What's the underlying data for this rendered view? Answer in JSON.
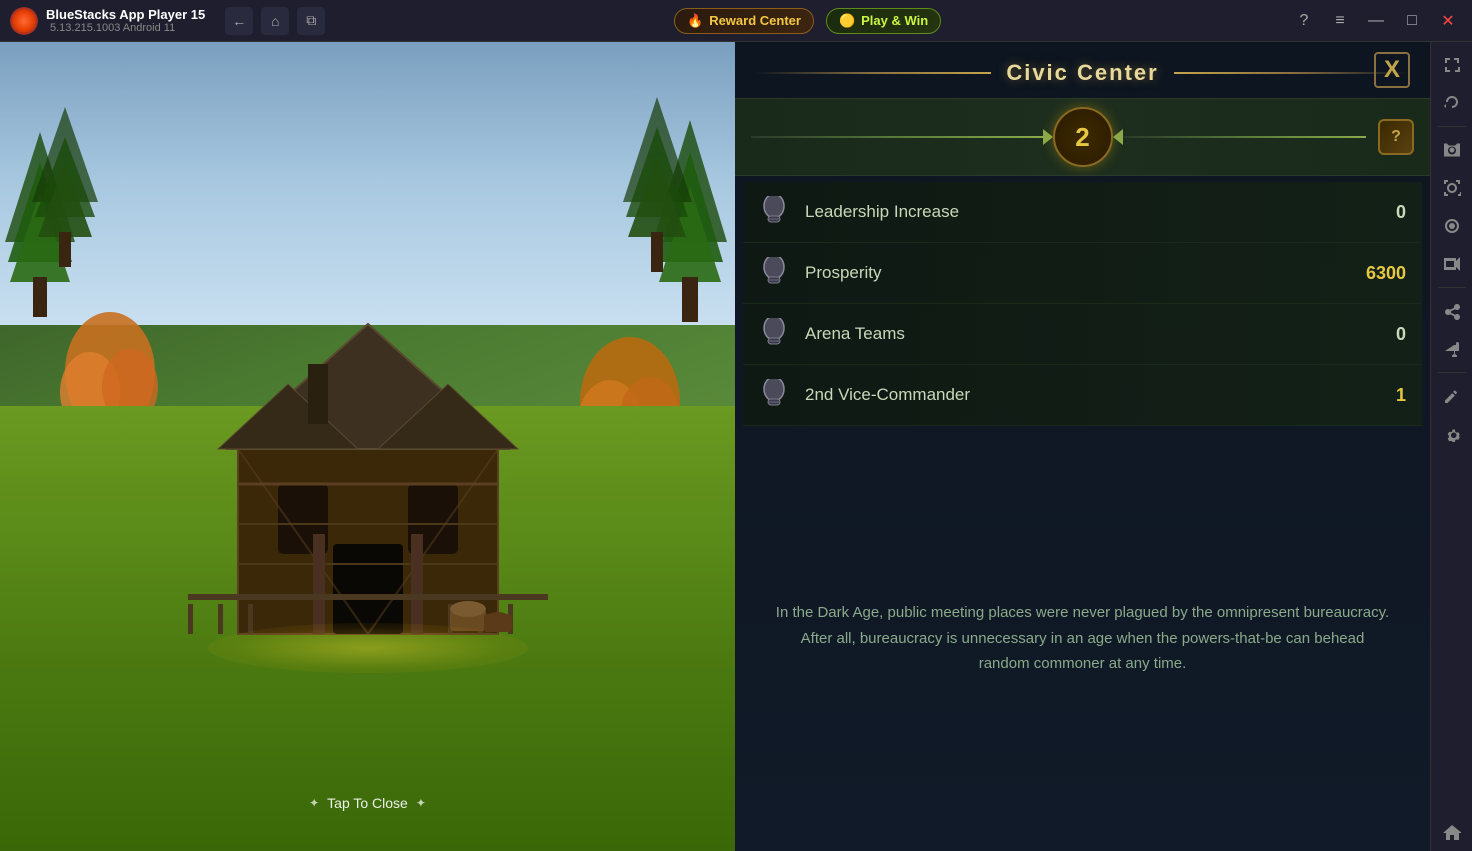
{
  "titlebar": {
    "app_name": "BlueStacks App Player 15",
    "version": "5.13.215.1003  Android 11",
    "nav": {
      "back_label": "←",
      "home_label": "⌂",
      "windows_label": "⧉"
    },
    "reward_center_label": "Reward Center",
    "play_win_label": "Play & Win",
    "help_label": "?",
    "menu_label": "≡",
    "minimize_label": "—",
    "maximize_label": "□",
    "close_label": "✕"
  },
  "panel": {
    "title": "Civic Center",
    "close_label": "X",
    "level": "2",
    "question_label": "?",
    "stats": [
      {
        "icon": "helmet-icon",
        "label": "Leadership Increase",
        "value": "0",
        "is_zero": true
      },
      {
        "icon": "helmet-icon",
        "label": "Prosperity",
        "value": "6300",
        "is_zero": false
      },
      {
        "icon": "helmet-icon",
        "label": "Arena Teams",
        "value": "0",
        "is_zero": true
      },
      {
        "icon": "helmet-icon",
        "label": "2nd Vice-Commander",
        "value": "1",
        "is_zero": false
      }
    ],
    "description": "In the Dark Age, public meeting places were never plagued by the omnipresent bureaucracy. After all, bureaucracy is unnecessary in an age when the powers-that-be can behead random commoner at any time."
  },
  "game": {
    "tap_to_close": "Tap To Close"
  },
  "sidebar": {
    "icons": [
      {
        "name": "expand-icon",
        "symbol": "⤢"
      },
      {
        "name": "rotate-icon",
        "symbol": "↻"
      },
      {
        "name": "camera-icon",
        "symbol": "📷"
      },
      {
        "name": "screenshot-icon",
        "symbol": "🖼"
      },
      {
        "name": "record-icon",
        "symbol": "⏺"
      },
      {
        "name": "video-icon",
        "symbol": "🎬"
      },
      {
        "name": "share-icon",
        "symbol": "↗"
      },
      {
        "name": "fly-icon",
        "symbol": "✈"
      },
      {
        "name": "edit-icon",
        "symbol": "✏"
      },
      {
        "name": "settings-icon",
        "symbol": "⚙"
      },
      {
        "name": "home-icon",
        "symbol": "⌂"
      },
      {
        "name": "more-icon",
        "symbol": "…"
      }
    ]
  }
}
